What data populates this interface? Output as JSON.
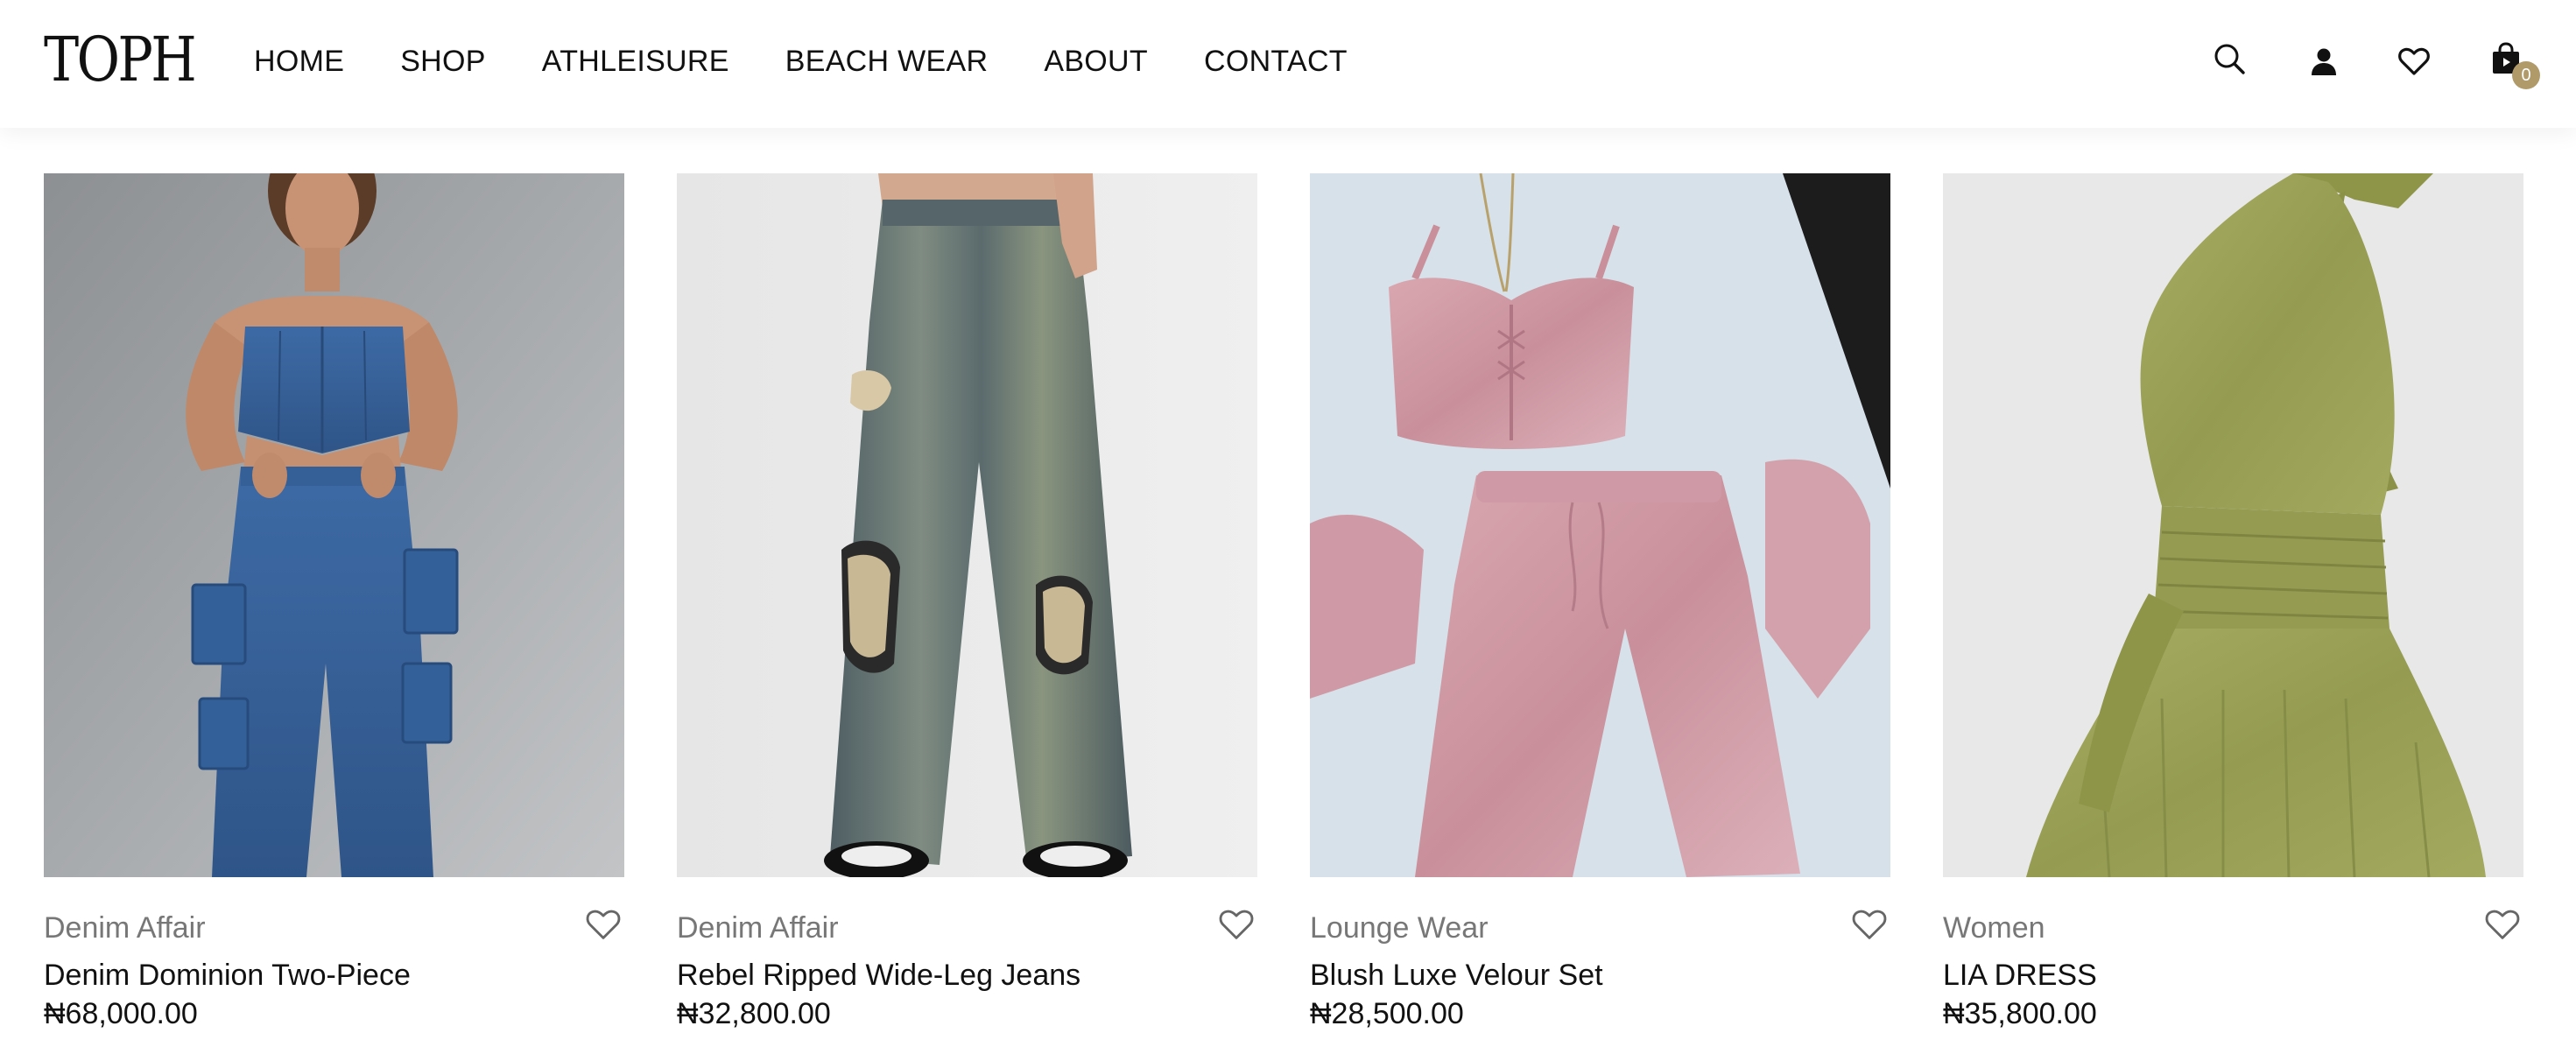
{
  "brand": {
    "logo_text": "TOPH"
  },
  "nav": [
    {
      "label": "HOME"
    },
    {
      "label": "SHOP"
    },
    {
      "label": "ATHLEISURE"
    },
    {
      "label": "BEACH WEAR"
    },
    {
      "label": "ABOUT"
    },
    {
      "label": "CONTACT"
    }
  ],
  "header_icons": {
    "search": "search-icon",
    "account": "user-icon",
    "wishlist": "heart-icon",
    "cart": "shopping-bag-icon",
    "cart_count": "0",
    "badge_color": "#b09a6a"
  },
  "products": [
    {
      "category": "Denim Affair",
      "title": "Denim Dominion Two-Piece",
      "price": "₦68,000.00"
    },
    {
      "category": "Denim Affair",
      "title": "Rebel Ripped Wide-Leg Jeans",
      "price": "₦32,800.00"
    },
    {
      "category": "Lounge Wear",
      "title": "Blush Luxe Velour Set",
      "price": "₦28,500.00"
    },
    {
      "category": "Women",
      "title": "LIA DRESS",
      "price": "₦35,800.00"
    }
  ]
}
